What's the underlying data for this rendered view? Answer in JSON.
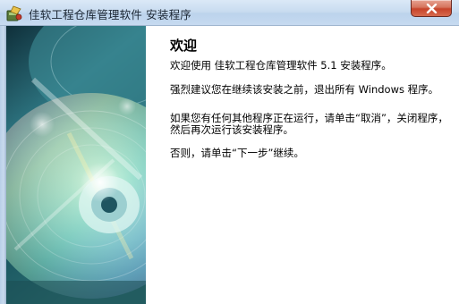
{
  "window": {
    "title": "佳软工程仓库管理软件 安装程序"
  },
  "welcome": {
    "heading": "欢迎",
    "para1": "欢迎使用 佳软工程仓库管理软件 5.1 安装程序。",
    "para2": "强烈建议您在继续该安装之前，退出所有 Windows 程序。",
    "para3": "如果您有任何其他程序正在运行，请单击“取消”，关闭程序，然后再次运行该安装程序。",
    "para4": "否则，请单击“下一步”继续。"
  },
  "icons": {
    "app": "installer-app-icon",
    "close": "close-icon",
    "art": "cd-disc-artwork"
  }
}
